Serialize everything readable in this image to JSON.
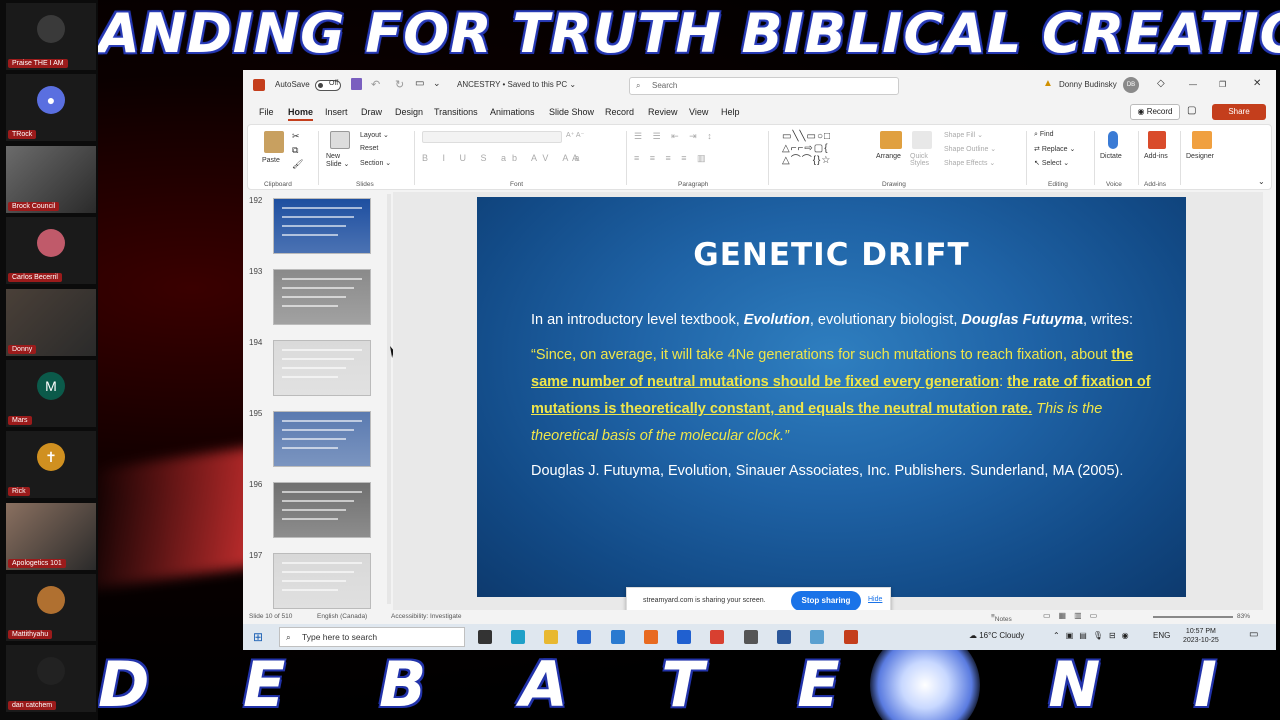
{
  "banner": {
    "top_text": "ANDING FOR TRUTH BIBLICAL CREATION",
    "bottom_text": "D E B A T E   N I G H T"
  },
  "participants": [
    {
      "name": "Praise THE I AM",
      "kind": "avatar",
      "color": "#3a3a3a",
      "icon": "bearded-face-avatar"
    },
    {
      "name": "TRock",
      "kind": "avatar",
      "color": "#5a6fe0",
      "icon": "person-silhouette-icon"
    },
    {
      "name": "Brock Council",
      "kind": "video",
      "color": "#6b6b6b"
    },
    {
      "name": "Carlos Becerril",
      "kind": "avatar",
      "color": "#c05a6a",
      "icon": "cartoon-avatar"
    },
    {
      "name": "Donny",
      "kind": "video",
      "color": "#4a4038"
    },
    {
      "name": "Mars",
      "kind": "avatar",
      "color": "#0b5a4a",
      "letter": "M"
    },
    {
      "name": "Rick",
      "kind": "avatar",
      "color": "#d09020",
      "icon": "cross-icon"
    },
    {
      "name": "Apologetics 101",
      "kind": "video",
      "color": "#8a7060"
    },
    {
      "name": "Mattithyahu",
      "kind": "avatar",
      "color": "#b07030",
      "icon": "person-avatar"
    },
    {
      "name": "dan catchem",
      "kind": "avatar",
      "color": "#222222",
      "icon": "person-avatar"
    }
  ],
  "window": {
    "autosave_label": "AutoSave",
    "autosave_state": "Off",
    "doc_title": "ANCESTRY • Saved to this PC ⌄",
    "search_placeholder": "Search",
    "user_name": "Donny Budinsky",
    "user_initials": "DB"
  },
  "menu": {
    "items": [
      "File",
      "Home",
      "Insert",
      "Draw",
      "Design",
      "Transitions",
      "Animations",
      "Slide Show",
      "Record",
      "Review",
      "View",
      "Help"
    ],
    "active": "Home",
    "record_label": "Record",
    "share_label": "Share"
  },
  "ribbon": {
    "paste": "Paste",
    "new_slide": "New Slide ⌄",
    "layout": "Layout ⌄",
    "reset": "Reset",
    "section": "Section ⌄",
    "arrange": "Arrange",
    "quick_styles": "Quick Styles",
    "shape_fill": "Shape Fill ⌄",
    "shape_outline": "Shape Outline ⌄",
    "shape_effects": "Shape Effects ⌄",
    "find": "Find",
    "replace": "Replace ⌄",
    "select": "Select ⌄",
    "dictate": "Dictate",
    "addins": "Add-ins",
    "designer": "Designer",
    "groups": {
      "clipboard": "Clipboard",
      "slides": "Slides",
      "font": "Font",
      "paragraph": "Paragraph",
      "drawing": "Drawing",
      "editing": "Editing",
      "voice": "Voice",
      "addins": "Add-ins"
    }
  },
  "thumbnails": [
    {
      "num": "192",
      "color": "#1e4fa0"
    },
    {
      "num": "193",
      "color": "#8a8a8a"
    },
    {
      "num": "194",
      "color": "#dadada"
    },
    {
      "num": "195",
      "color": "#5a7ab0"
    },
    {
      "num": "196",
      "color": "#707070"
    },
    {
      "num": "197",
      "color": "#d8d8d8"
    }
  ],
  "slide": {
    "title": "GENETIC DRIFT",
    "p1_a": "In an introductory level textbook, ",
    "p1_b": "Evolution",
    "p1_c": ", evolutionary biologist, ",
    "p1_d": "Douglas Futuyma",
    "p1_e": ", writes:",
    "q_a": "“Since, on average, it will take 4Ne generations for such mutations to reach fixation, about ",
    "q_b": "the same number of neutral mutations should be fixed every generation",
    "q_c": ": ",
    "q_d": "the rate of fixation of mutations is theoretically constant, and equals the neutral mutation rate.",
    "q_e": " This is the theoretical basis of the molecular clock.”",
    "citation": "Douglas J. Futuyma, Evolution, Sinauer Associates, Inc. Publishers. Sunderland, MA (2005)."
  },
  "status": {
    "slide_count": "Slide 10 of 510",
    "language": "English (Canada)",
    "accessibility": "Accessibility: Investigate",
    "notes": "Notes",
    "zoom": "83%"
  },
  "share_notice": {
    "message": "streamyard.com is sharing your screen.",
    "stop": "Stop sharing",
    "hide": "Hide"
  },
  "taskbar": {
    "search_placeholder": "Type here to search",
    "weather": "16°C Cloudy",
    "lang": "ENG",
    "time": "10:57 PM",
    "date": "2023-10-25"
  },
  "colors": {
    "ppt_accent": "#c43e1c",
    "slide_bg": "#1f63a6",
    "highlight_yellow": "#f0e64a",
    "name_tag": "#9b1b1b"
  }
}
